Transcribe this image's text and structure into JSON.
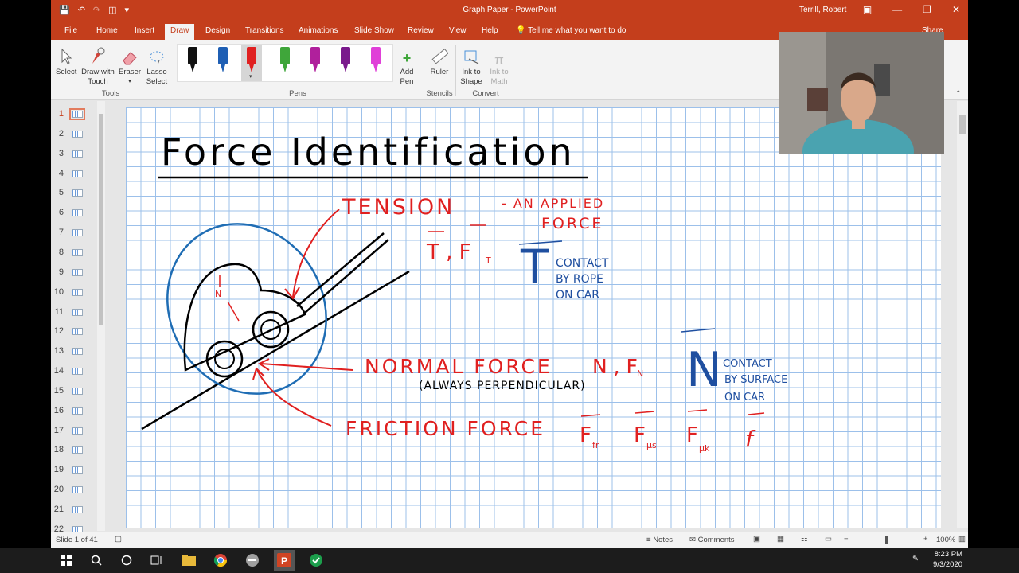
{
  "app": {
    "doc_title": "Graph Paper - PowerPoint",
    "user": "Terrill, Robert",
    "tell_me": "Tell me what you want to do",
    "share": "Share"
  },
  "tabs": [
    {
      "label": "File",
      "active": false
    },
    {
      "label": "Home",
      "active": false
    },
    {
      "label": "Insert",
      "active": false
    },
    {
      "label": "Draw",
      "active": true
    },
    {
      "label": "Design",
      "active": false
    },
    {
      "label": "Transitions",
      "active": false
    },
    {
      "label": "Animations",
      "active": false
    },
    {
      "label": "Slide Show",
      "active": false
    },
    {
      "label": "Review",
      "active": false
    },
    {
      "label": "View",
      "active": false
    },
    {
      "label": "Help",
      "active": false
    }
  ],
  "ribbon": {
    "tools": {
      "select": "Select",
      "draw_touch_1": "Draw with",
      "draw_touch_2": "Touch",
      "eraser": "Eraser",
      "lasso_1": "Lasso",
      "lasso_2": "Select",
      "label": "Tools"
    },
    "pens": {
      "label": "Pens",
      "colors": [
        "#111111",
        "#1f5fb4",
        "#e02020",
        "#3fa63a",
        "#b0209c",
        "#7a1a8c",
        "#e040d8"
      ],
      "selected_index": 2
    },
    "add_pen_1": "Add",
    "add_pen_2": "Pen",
    "stencils": {
      "ruler": "Ruler",
      "label": "Stencils"
    },
    "convert": {
      "ink_shape_1": "Ink to",
      "ink_shape_2": "Shape",
      "ink_math_1": "Ink to",
      "ink_math_2": "Math",
      "label": "Convert"
    }
  },
  "slides": {
    "numbers": [
      "1",
      "2",
      "3",
      "4",
      "5",
      "6",
      "7",
      "8",
      "9",
      "10",
      "11",
      "12",
      "13",
      "14",
      "15",
      "16",
      "17",
      "18",
      "19",
      "20",
      "21",
      "22"
    ],
    "current": 1
  },
  "slide_ink": {
    "title": "Force Identification",
    "tension": "TENSION",
    "applied": "- AN APPLIED",
    "applied2": "FORCE",
    "tension_syms": "T , F",
    "tension_sub": "T",
    "big_t": "T",
    "contact_rope_1": "CONTACT",
    "contact_rope_2": "BY ROPE",
    "contact_rope_3": "ON CAR",
    "normal": "NORMAL FORCE",
    "normal_syms": "N , F",
    "normal_sub": "N",
    "always_perp": "(ALWAYS PERPENDICULAR)",
    "big_n": "N",
    "contact_surf_1": "CONTACT",
    "contact_surf_2": "BY SURFACE",
    "contact_surf_3": "ON CAR",
    "friction": "FRICTION FORCE",
    "friction_syms": "F",
    "friction_subs": [
      "fr",
      "μs",
      "μk"
    ],
    "friction_f": "f",
    "car_n": "N"
  },
  "status": {
    "slide_of": "Slide 1 of 41",
    "notes": "Notes",
    "comments": "Comments",
    "zoom": "100%",
    "zoom_fraction": 0.5
  },
  "taskbar": {
    "time": "8:23 PM",
    "date": "9/3/2020"
  }
}
